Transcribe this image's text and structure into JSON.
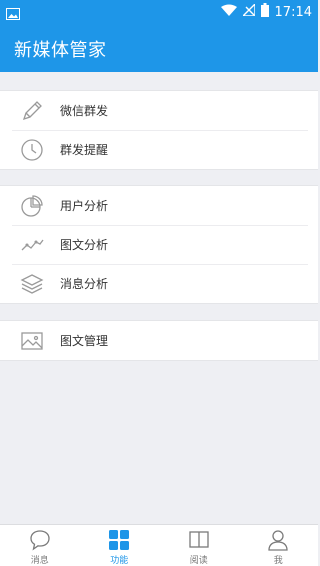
{
  "status_bar": {
    "time": "17:14"
  },
  "app_bar": {
    "title": "新媒体管家"
  },
  "menu_groups": [
    {
      "items": [
        {
          "label": "微信群发",
          "icon": "pencil-icon"
        },
        {
          "label": "群发提醒",
          "icon": "clock-icon"
        }
      ]
    },
    {
      "items": [
        {
          "label": "用户分析",
          "icon": "pie-chart-icon"
        },
        {
          "label": "图文分析",
          "icon": "line-chart-icon"
        },
        {
          "label": "消息分析",
          "icon": "layers-icon"
        }
      ]
    },
    {
      "items": [
        {
          "label": "图文管理",
          "icon": "image-icon"
        }
      ]
    }
  ],
  "tabs": [
    {
      "label": "消息",
      "icon": "chat-bubble-icon",
      "active": false
    },
    {
      "label": "功能",
      "icon": "grid-icon",
      "active": true
    },
    {
      "label": "阅读",
      "icon": "book-icon",
      "active": false
    },
    {
      "label": "我",
      "icon": "user-icon",
      "active": false
    }
  ],
  "colors": {
    "primary": "#1e96e8",
    "background": "#eeeff3",
    "icon_gray": "#9a9a9a"
  }
}
